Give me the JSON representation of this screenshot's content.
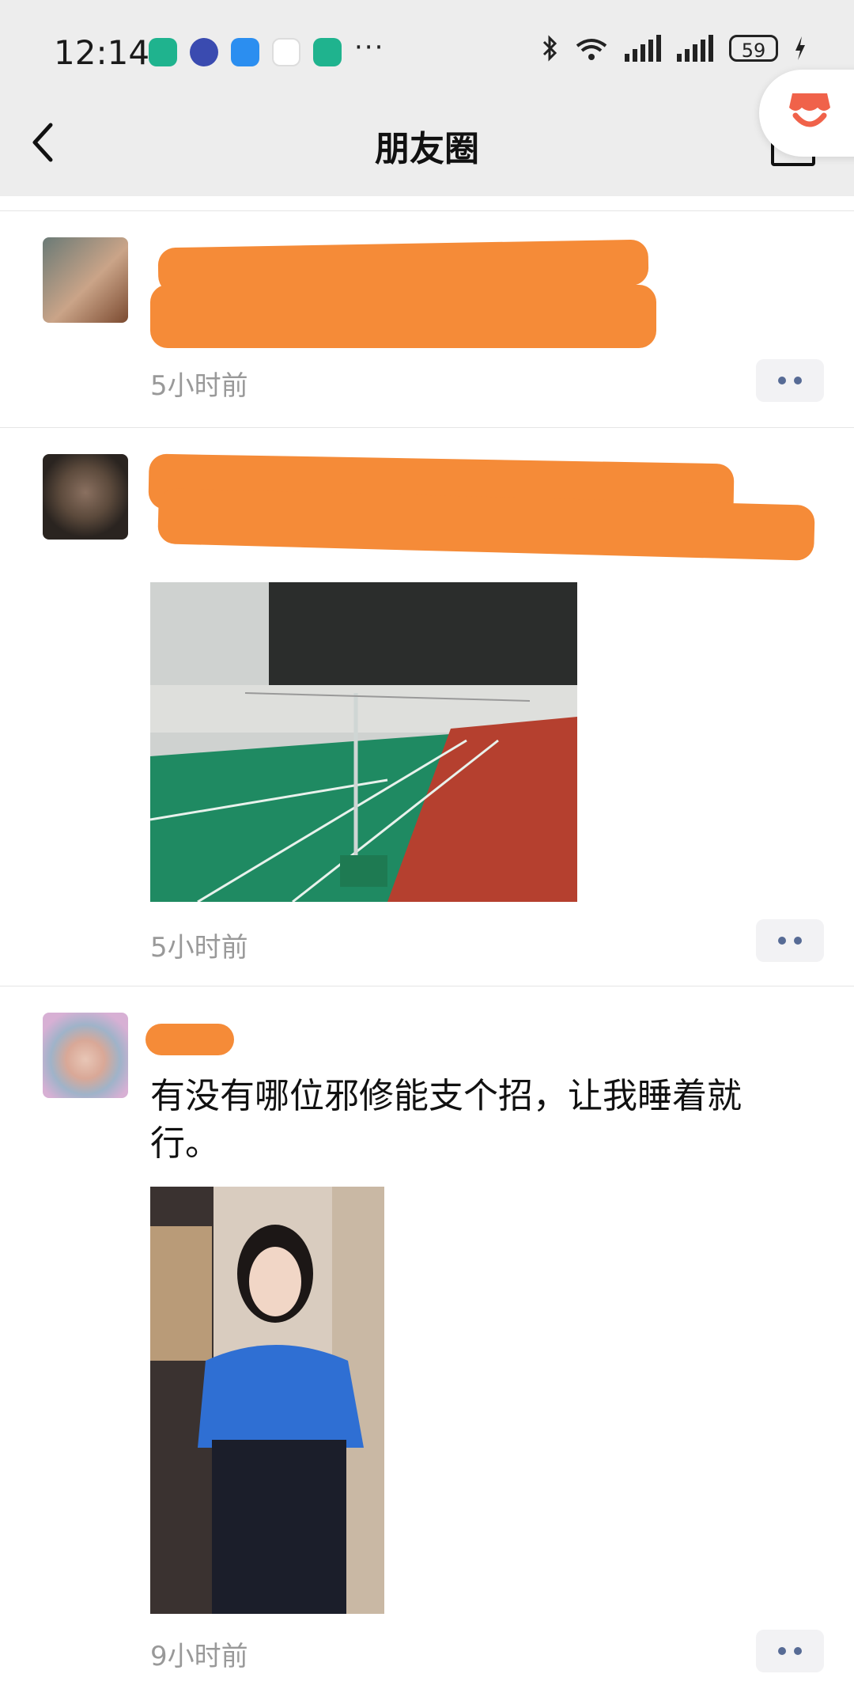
{
  "status_bar": {
    "time": "12:14",
    "more": "···",
    "battery": "59"
  },
  "header": {
    "title": "朋友圈"
  },
  "posts": [
    {
      "time": "5小时前"
    },
    {
      "time": "5小时前"
    },
    {
      "text": "有没有哪位邪修能支个招，让我睡着就行。",
      "time": "9小时前"
    }
  ],
  "colors": {
    "redaction": "#f58b38",
    "link_blue": "#576b95"
  }
}
